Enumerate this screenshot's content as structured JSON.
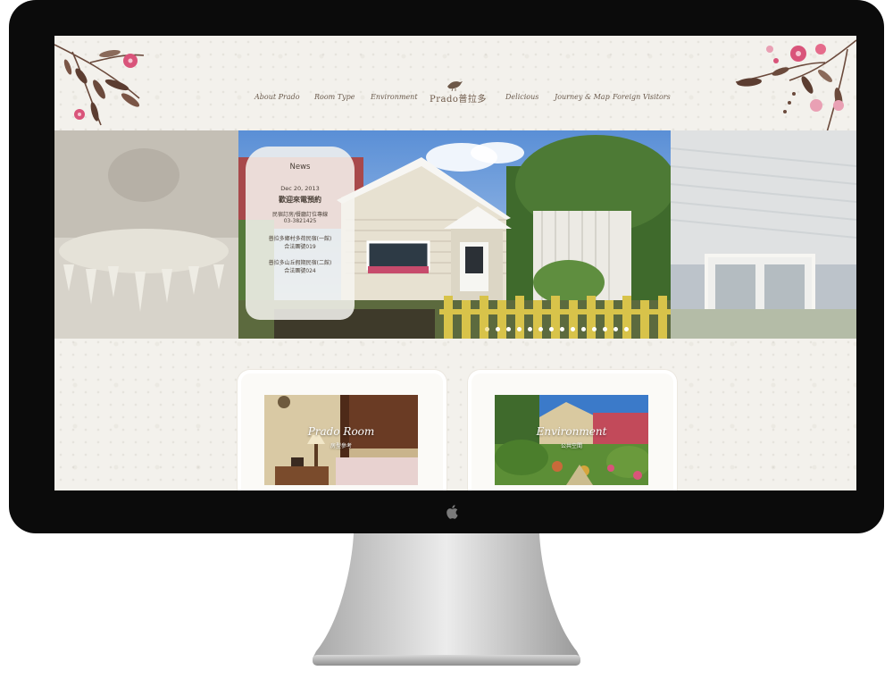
{
  "nav": {
    "items": [
      {
        "label": "About Prado"
      },
      {
        "label": "Room Type"
      },
      {
        "label": "Environment"
      },
      {
        "label": "Delicious"
      },
      {
        "label": "Journey & Map"
      },
      {
        "label": "Foreign Visitors"
      }
    ],
    "logo_text": "Prado普拉多"
  },
  "news": {
    "title": "News",
    "date": "Dec 20, 2013",
    "headline": "歡迎來電預約",
    "lines": [
      "民宿訂房/餐廳訂位專線",
      "03-3821425",
      "普拉多鄉村多荷民宿(一館)",
      "合法團號019",
      "普拉多山丘假期民宿(二館)",
      "合法團號024"
    ]
  },
  "slider": {
    "dot_count": 14,
    "active_dot": 0
  },
  "cards": [
    {
      "title": "Prado Room",
      "subtitle": "房型參考"
    },
    {
      "title": "Environment",
      "subtitle": "公共空間"
    }
  ],
  "colors": {
    "accent": "#6a5a4c",
    "flower": "#d9547a",
    "background": "#f3f1ec"
  }
}
